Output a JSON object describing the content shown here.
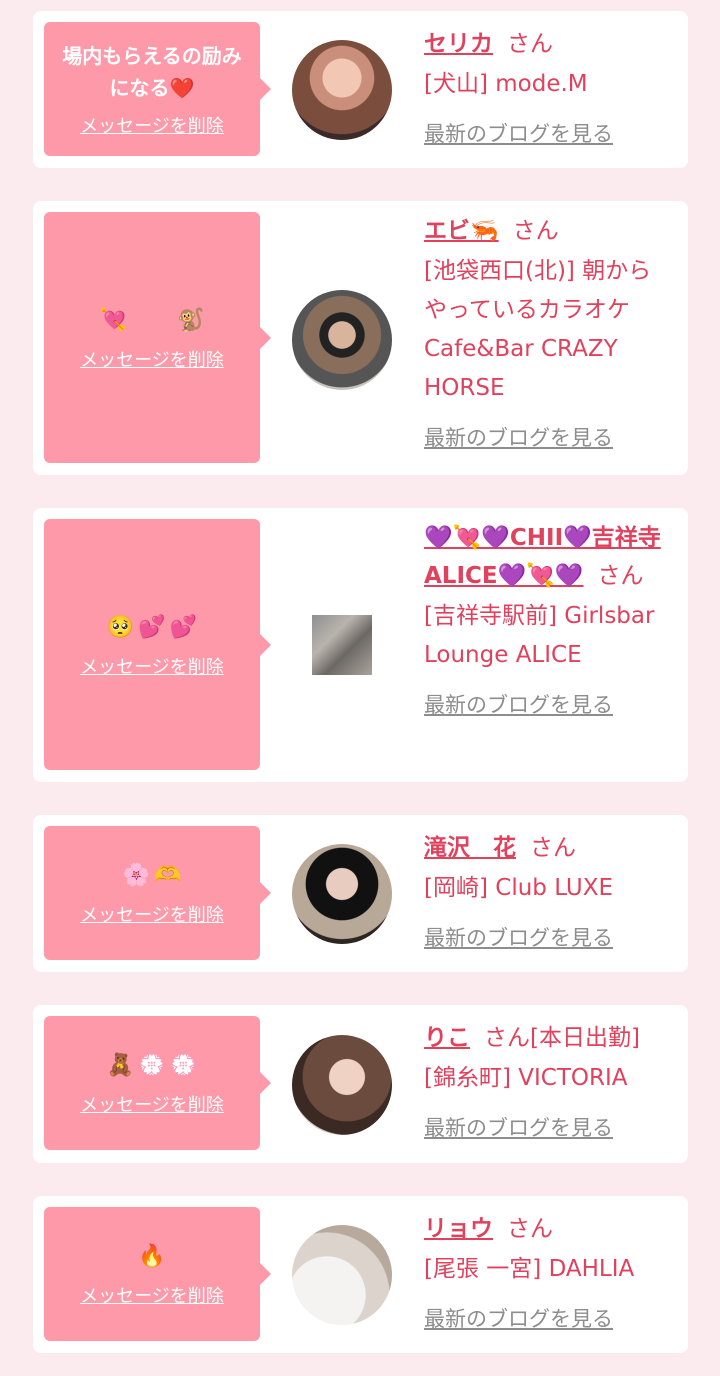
{
  "common": {
    "delete_label": "メッセージを削除",
    "blog_label": "最新のブログを見る",
    "san": "さん"
  },
  "items": [
    {
      "message": "場内もらえるの励みになる❤️",
      "name": "セリカ",
      "san_suffix": "さん",
      "shop": "[犬山] mode.M"
    },
    {
      "message_emojis": [
        "💘",
        "🐒"
      ],
      "name": "エビ🦐",
      "san_suffix": "さん",
      "shop": "[池袋西口(北)] 朝からやっているカラオケCafe&Bar CRAZY HORSE"
    },
    {
      "message_emojis": [
        "🥺",
        "💕",
        "💕"
      ],
      "name": "💜💘💜CHII💜吉祥寺ALICE💜💘💜",
      "san_suffix": "さん",
      "shop": "[吉祥寺駅前] Girlsbar Lounge ALICE"
    },
    {
      "message_emojis": [
        "🌸",
        "🫶"
      ],
      "name": "滝沢　花",
      "san_suffix": "さん",
      "shop": "[岡崎] Club LUXE"
    },
    {
      "message_emojis": [
        "🧸",
        "💮",
        "💮"
      ],
      "name": "りこ",
      "san_suffix": "さん[本日出勤]",
      "shop": "[錦糸町] VICTORIA"
    },
    {
      "message_emojis": [
        "🔥"
      ],
      "name": "リョウ",
      "san_suffix": "さん",
      "shop": "[尾張 一宮] DAHLIA"
    }
  ],
  "colors": {
    "background": "#fcebee",
    "bubble": "#fd99a8",
    "accent": "#e0415d",
    "link_gray": "#8d8d8d"
  }
}
